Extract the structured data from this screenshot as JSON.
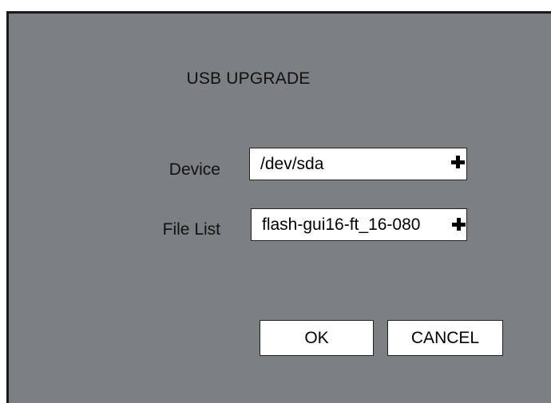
{
  "dialog": {
    "title": "USB UPGRADE",
    "device": {
      "label": "Device",
      "value": "/dev/sda"
    },
    "file_list": {
      "label": "File List",
      "value": "flash-gui16-ft_16-080"
    },
    "buttons": {
      "ok": "OK",
      "cancel": "CANCEL"
    }
  },
  "colors": {
    "background": "#7c8082",
    "field": "#ffffff",
    "text": "#111111"
  },
  "icons": {
    "expand": "plus-icon"
  }
}
